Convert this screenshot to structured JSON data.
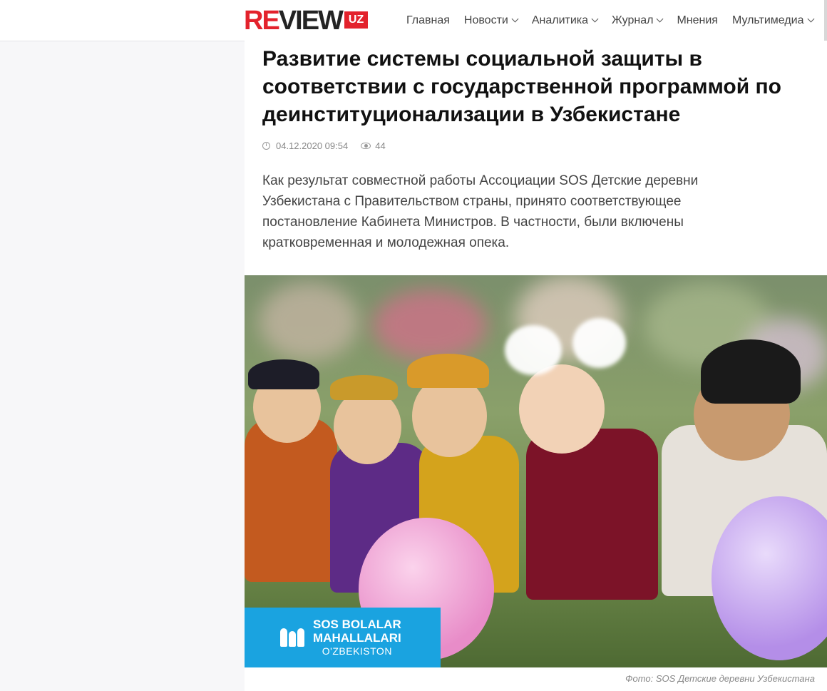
{
  "header": {
    "logo": {
      "re": "RE",
      "view": "VIEW",
      "uz": "UZ"
    },
    "nav": [
      {
        "label": "Главная",
        "dropdown": false
      },
      {
        "label": "Новости",
        "dropdown": true
      },
      {
        "label": "Аналитика",
        "dropdown": true
      },
      {
        "label": "Журнал",
        "dropdown": true
      },
      {
        "label": "Мнения",
        "dropdown": false
      },
      {
        "label": "Мультимедиа",
        "dropdown": true
      }
    ]
  },
  "article": {
    "title": "Развитие системы социальной защиты в соответствии с государственной программой по деинституционализации в Узбекистане",
    "date": "04.12.2020 09:54",
    "views": "44",
    "lead": "Как результат совместной работы Ассоциации SOS Детские деревни Узбекистана с Правительством страны, принято соответствующее постановление Кабинета Министров. В частности, были включены кратковременная и молодежная опека.",
    "image": {
      "logo_line1": "SOS BOLALAR",
      "logo_line2": "MAHALLALARI",
      "logo_line3": "O'ZBEKISTON",
      "caption": "Фото: SOS Детские деревни Узбекистана"
    }
  },
  "colors": {
    "brand_red": "#e3222c",
    "sos_blue": "#1aa3e0",
    "title_text": "#111111",
    "muted_text": "#888888"
  }
}
